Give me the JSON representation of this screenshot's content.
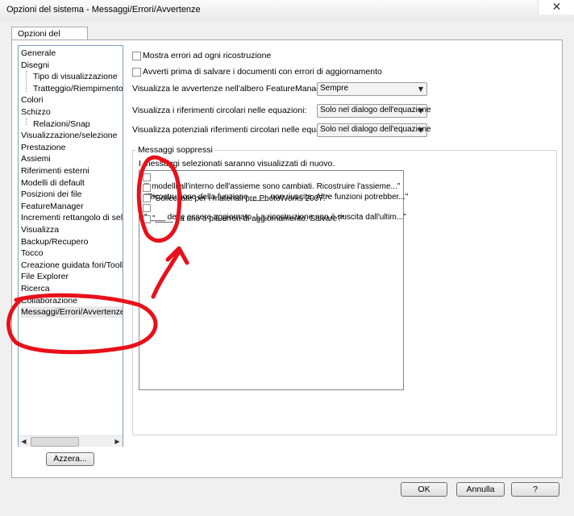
{
  "window": {
    "title": "Opzioni del sistema - Messaggi/Errori/Avvertenze",
    "close_glyph": "✕"
  },
  "tab": {
    "label": "Opzioni del sistema"
  },
  "tree": {
    "items": [
      {
        "label": "Generale"
      },
      {
        "label": "Disegni"
      },
      {
        "label": "Tipo di visualizzazione",
        "sub": true
      },
      {
        "label": "Tratteggio/Riempimento",
        "sub": true
      },
      {
        "label": "Colori"
      },
      {
        "label": "Schizzo"
      },
      {
        "label": "Relazioni/Snap",
        "sub": true
      },
      {
        "label": "Visualizzazione/selezione"
      },
      {
        "label": "Prestazione"
      },
      {
        "label": "Assiemi"
      },
      {
        "label": "Riferimenti esterni"
      },
      {
        "label": "Modelli di default"
      },
      {
        "label": "Posizioni dei file"
      },
      {
        "label": "FeatureManager"
      },
      {
        "label": "Incrementi rettangolo di selez"
      },
      {
        "label": "Visualizza"
      },
      {
        "label": "Backup/Recupero"
      },
      {
        "label": "Tocco"
      },
      {
        "label": "Creazione guidata fori/Toolbo"
      },
      {
        "label": "File Explorer"
      },
      {
        "label": "Ricerca"
      },
      {
        "label": "Collaborazione"
      },
      {
        "label": "Messaggi/Errori/Avvertenze",
        "selected": true
      }
    ]
  },
  "buttons": {
    "reset": "Azzera...",
    "ok": "OK",
    "cancel": "Annulla",
    "help": "?"
  },
  "options": {
    "show_errors": "Mostra errori ad ogni ricostruzione",
    "warn_before_save": "Avverti prima di salvare i documenti con errori di aggiornamento",
    "show_warnings_label": "Visualizza le avvertenze nell'albero FeatureManager:",
    "show_warnings_value": "Sempre",
    "circular_refs_label": "Visualizza i riferimenti circolari nelle equazioni:",
    "circular_refs_value": "Solo nel dialogo dell'equazione",
    "potential_circular_label": "Visualizza potenziali riferimenti circolari nelle equazioni:",
    "potential_circular_value": "Solo nel dialogo dell'equazione"
  },
  "suppressed": {
    "title": "Messaggi soppressi",
    "description": "I messaggi selezionati saranno visualizzati di nuovo.",
    "messages": [
      "\"I modelli all'interno dell'assieme sono cambiati. Ricostruire l'assieme...\"",
      "\"Ricostruzione della funzione ____ non riuscita. Altre funzioni potrebber...\"",
      "\"Sollecitate per i materiali pre PhotoWorks 2007.\"",
      "\"____ deve essere aggiornato.  La ricostruzione non è riuscita dall'ultim...\"",
      "\"____ ha uno o più errori di aggiornamento. Salvare?\""
    ]
  },
  "annotation": {
    "color": "#e8101a"
  }
}
